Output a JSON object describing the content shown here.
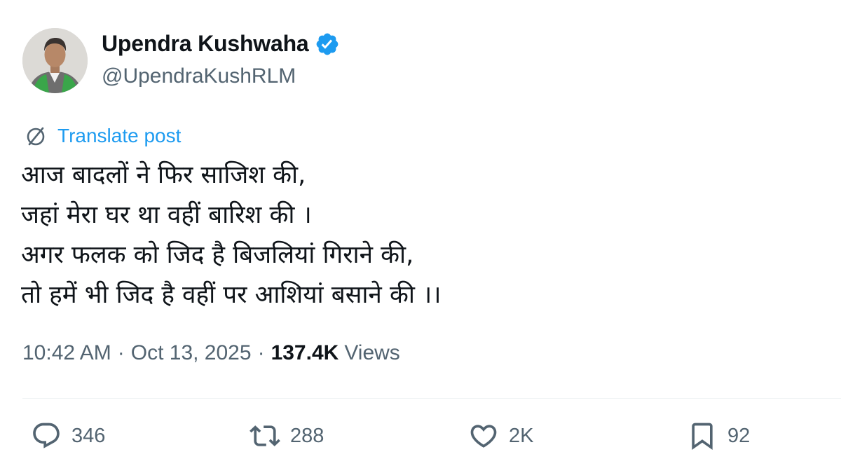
{
  "author": {
    "display_name": "Upendra Kushwaha",
    "handle": "@UpendraKushRLM",
    "verified": true,
    "avatar_icon": "profile-photo"
  },
  "translate": {
    "label": "Translate post",
    "icon": "globe-icon"
  },
  "tweet": {
    "lines": [
      "आज बादलों ने फिर साजिश की,",
      "जहां मेरा घर था वहीं बारिश की ।",
      "अगर फलक को जिद है बिजलियां गिराने की,",
      "तो हमें भी जिद है वहीं पर आशियां बसाने की ।।"
    ]
  },
  "meta": {
    "time": "10:42 AM",
    "separator": "·",
    "date": "Oct 13, 2025",
    "views_count": "137.4K",
    "views_label": "Views"
  },
  "actions": {
    "replies": "346",
    "reposts": "288",
    "likes": "2K",
    "bookmarks": "92"
  },
  "colors": {
    "text": "#0f1419",
    "secondary": "#536471",
    "accent": "#1d9bf0",
    "divider": "#eff3f4"
  }
}
